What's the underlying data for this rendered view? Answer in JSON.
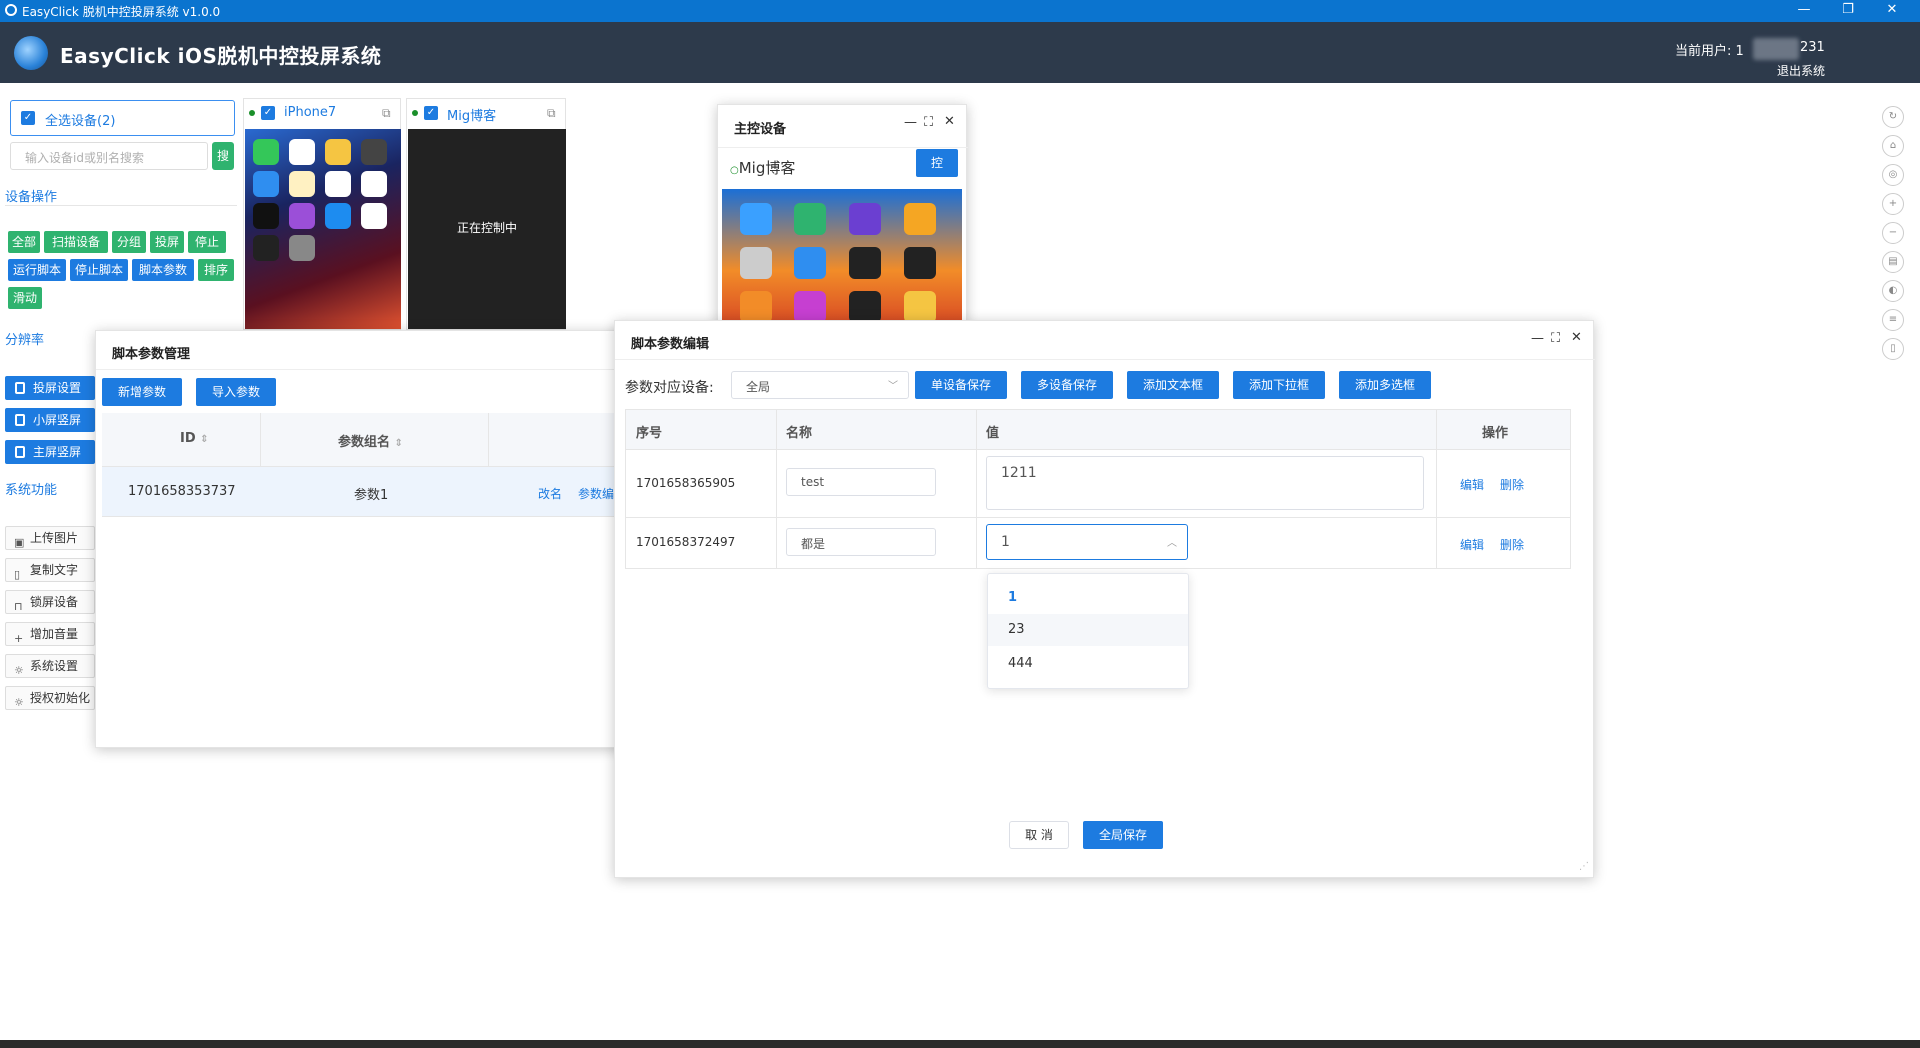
{
  "window": {
    "title": "EasyClick 脱机中控投屏系统 v1.0.0"
  },
  "header": {
    "app_title": "EasyClick iOS脱机中控投屏系统",
    "user_label": "当前用户: 1",
    "user_suffix": "231",
    "logout": "退出系统"
  },
  "sidebar": {
    "select_all": "全选设备(2)",
    "search_placeholder": "输入设备id或别名搜索",
    "search_btn": "搜",
    "device_ops_title": "设备操作",
    "ops_row1": [
      "全部",
      "扫描设备",
      "分组",
      "投屏",
      "停止"
    ],
    "ops_row2": [
      "运行脚本",
      "停止脚本",
      "脚本参数",
      "排序"
    ],
    "ops_row3": [
      "滑动"
    ],
    "resolution_title": "分辨率",
    "screen_btns": [
      "投屏设置",
      "小屏竖屏",
      "主屏竖屏"
    ],
    "sys_title": "系统功能",
    "sys_btns": [
      "上传图片",
      "复制文字",
      "锁屏设备",
      "增加音量",
      "系统设置",
      "授权初始化"
    ]
  },
  "devices": [
    {
      "name": "iPhone7"
    },
    {
      "name": "Mig博客",
      "status": "正在控制中"
    }
  ],
  "master": {
    "title": "主控设备",
    "device": "Mig博客",
    "control_btn": "控"
  },
  "param_mgr": {
    "title": "脚本参数管理",
    "add_btn": "新增参数",
    "import_btn": "导入参数",
    "columns": [
      "ID",
      "参数组名"
    ],
    "rows": [
      {
        "id": "1701658353737",
        "name": "参数1",
        "rename": "改名",
        "params": "参数编"
      }
    ]
  },
  "param_edit": {
    "title": "脚本参数编辑",
    "device_label": "参数对应设备:",
    "device_value": "全局",
    "buttons": [
      "单设备保存",
      "多设备保存",
      "添加文本框",
      "添加下拉框",
      "添加多选框"
    ],
    "columns": [
      "序号",
      "名称",
      "值",
      "操作"
    ],
    "rows": [
      {
        "id": "1701658365905",
        "name": "test",
        "value": "1211",
        "edit": "编辑",
        "del": "删除"
      },
      {
        "id": "1701658372497",
        "name": "都是",
        "value": "1",
        "edit": "编辑",
        "del": "删除"
      }
    ],
    "dropdown": [
      "1",
      "23",
      "444"
    ],
    "cancel": "取 消",
    "save_all": "全局保存"
  }
}
